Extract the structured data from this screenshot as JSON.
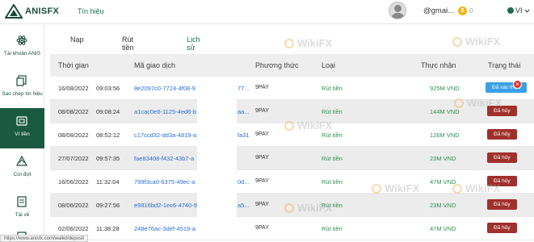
{
  "header": {
    "logo_text": "ANISFX",
    "nav_label": "Tín hiệu",
    "email": "@gmai...",
    "coin_value": "0",
    "lang": "VI"
  },
  "sidebar": {
    "items": [
      {
        "label": "Tài khoản ANIS",
        "icon": "atom-icon"
      },
      {
        "label": "Sao chép tín hiệu",
        "icon": "copy-icon"
      },
      {
        "label": "Ví tiền",
        "icon": "wallet-icon",
        "active": true
      },
      {
        "label": "Cơi đợt",
        "icon": "chevron-icon"
      },
      {
        "label": "Tài về",
        "icon": "document-icon"
      }
    ]
  },
  "tabs": [
    {
      "label": "Nạp"
    },
    {
      "label": "Rút tiền"
    },
    {
      "label": "Lịch sử",
      "active": true
    }
  ],
  "table": {
    "headers": [
      "Thời gian",
      "Mã giao dịch",
      "Phương thức",
      "Loại",
      "Thực nhận",
      "Trạng thái"
    ],
    "rows": [
      {
        "date": "16/08/2022",
        "time": "09:03:56",
        "id_left": "8e2097c0-7724-4f08-9",
        "id_right": "77...",
        "method": "9PAY",
        "type": "Rút tiền",
        "amount": "925M VND",
        "status": "Đã xác thực",
        "status_kind": "pending"
      },
      {
        "date": "08/08/2022",
        "time": "09:08:24",
        "id_left": "a1cac0e6-1125-4ed6-b",
        "id_right": "aa...",
        "method": "9PAY",
        "type": "Rút tiền",
        "amount": "144M VND",
        "status": "Đã hủy",
        "status_kind": "cancel"
      },
      {
        "date": "08/08/2022",
        "time": "08:52:12",
        "id_left": "c17ccd32-dd3a-4819-a",
        "id_right": "fa31",
        "method": "9PAY",
        "type": "Rút tiền",
        "amount": "126M VND",
        "status": "Đã hủy",
        "status_kind": "cancel"
      },
      {
        "date": "27/07/2022",
        "time": "09:57:35",
        "id_left": "fae83408-f432-43b7-a",
        "id_right": "",
        "method": "9PAY",
        "type": "Rút tiền",
        "amount": "23M VND",
        "status": "Đã hủy",
        "status_kind": "cancel"
      },
      {
        "date": "16/06/2022",
        "time": "11:32:04",
        "id_left": "799f3ca0-6375-49ec-a",
        "id_right": "0d...",
        "method": "9PAY",
        "type": "Rút tiền",
        "amount": "47M VND",
        "status": "Đã hủy",
        "status_kind": "cancel"
      },
      {
        "date": "08/06/2022",
        "time": "09:27:56",
        "id_left": "e9816bd2-1ec6-4740-9",
        "id_right": "a5...",
        "method": "9PAY",
        "type": "Rút tiền",
        "amount": "23M VND",
        "status": "Đã hủy",
        "status_kind": "cancel"
      },
      {
        "date": "02/06/2022",
        "time": "11:38:28",
        "id_left": "248e76ac-3def-4519-a",
        "id_right": "",
        "method": "9PAY",
        "type": "Rút tiền",
        "amount": "47M VND",
        "status": "Đã hủy",
        "status_kind": "cancel"
      }
    ]
  },
  "watermark": "WikiFX",
  "status_url": "https://www.anisfx.com/wallet/deposit",
  "colors": {
    "brand_green": "#1b5a42",
    "link_blue": "#2b6fd6",
    "amount_green": "#2f8f55",
    "cancel_red": "#a0302c",
    "pending_blue": "#3aa0e8"
  }
}
